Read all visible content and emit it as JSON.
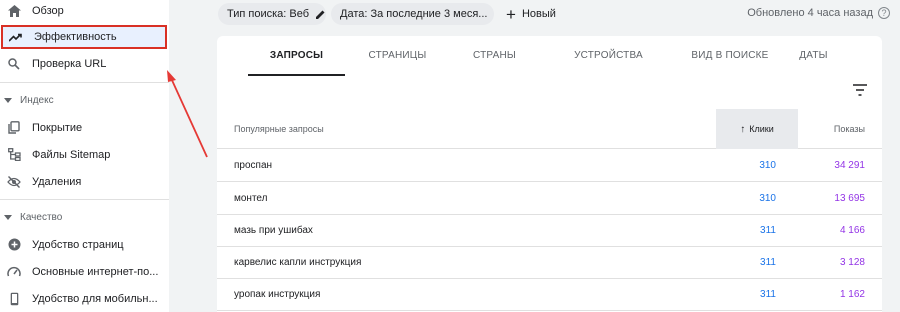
{
  "sidebar": {
    "items_top": [
      {
        "label": "Обзор",
        "icon": "home-icon"
      },
      {
        "label": "Эффективность",
        "icon": "trending-up-icon",
        "active": true
      },
      {
        "label": "Проверка URL",
        "icon": "search-icon"
      }
    ],
    "section_index": {
      "title": "Индекс",
      "items": [
        {
          "label": "Покрытие",
          "icon": "copy-icon"
        },
        {
          "label": "Файлы Sitemap",
          "icon": "sitemap-icon"
        },
        {
          "label": "Удаления",
          "icon": "eye-off-icon"
        }
      ]
    },
    "section_quality": {
      "title": "Качество",
      "items": [
        {
          "label": "Удобство страниц",
          "icon": "add-circle-icon"
        },
        {
          "label": "Основные интернет-по...",
          "icon": "speed-icon"
        },
        {
          "label": "Удобство для мобильн...",
          "icon": "smartphone-icon"
        }
      ]
    }
  },
  "filters": {
    "chip_type": "Тип поиска: Веб",
    "chip_date": "Дата: За последние 3 меся...",
    "new_label": "Новый",
    "updated": "Обновлено 4 часа назад"
  },
  "tabs": [
    "ЗАПРОСЫ",
    "СТРАНИЦЫ",
    "СТРАНЫ",
    "УСТРОЙСТВА",
    "ВИД В ПОИСКЕ",
    "ДАТЫ"
  ],
  "table": {
    "headers": {
      "query": "Популярные запросы",
      "clicks": "Клики",
      "impressions": "Показы"
    },
    "rows": [
      {
        "query": "проспан",
        "clicks": "310",
        "impressions": "34 291"
      },
      {
        "query": "монтел",
        "clicks": "310",
        "impressions": "13 695"
      },
      {
        "query": "мазь при ушибах",
        "clicks": "311",
        "impressions": "4 166"
      },
      {
        "query": "карвелис капли инструкция",
        "clicks": "311",
        "impressions": "3 128"
      },
      {
        "query": "уропак инструкция",
        "clicks": "311",
        "impressions": "1 162"
      }
    ]
  },
  "colors": {
    "clicks": "#1a73e8",
    "impressions": "#9334e6",
    "highlight_box": "#d93025",
    "annotation_arrow": "#e53935"
  }
}
